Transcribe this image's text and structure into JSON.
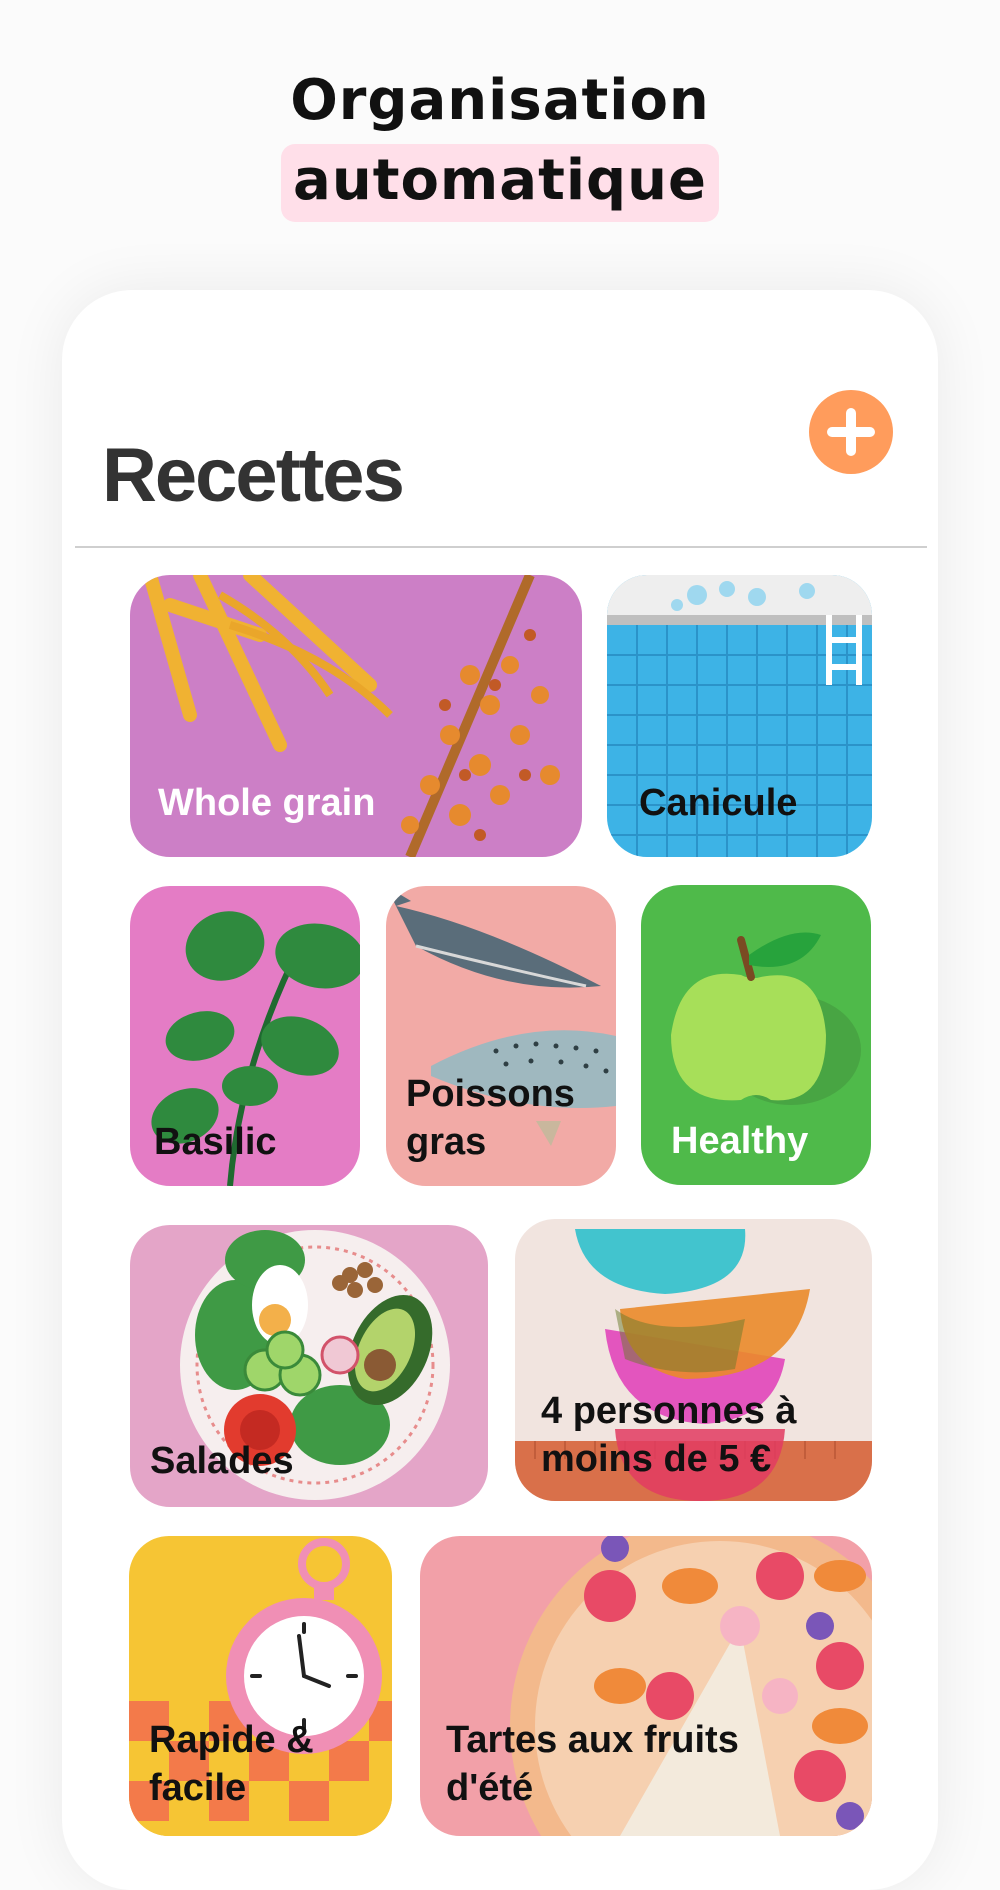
{
  "headline": {
    "line1": "Organisation",
    "line2": "automatique"
  },
  "screen": {
    "title": "Recettes",
    "add_icon": "plus-icon"
  },
  "colors": {
    "highlight": "#ffdfe9",
    "accent": "#ff9c5c"
  },
  "categories": [
    {
      "label": "Whole grain"
    },
    {
      "label": "Canicule"
    },
    {
      "label": "Basilic"
    },
    {
      "label": "Poissons\ngras"
    },
    {
      "label": "Healthy"
    },
    {
      "label": "Salades"
    },
    {
      "label": "4 personnes à\nmoins de 5 €"
    },
    {
      "label": "Rapide &\nfacile"
    },
    {
      "label": "Tartes aux fruits\nd'été"
    }
  ]
}
